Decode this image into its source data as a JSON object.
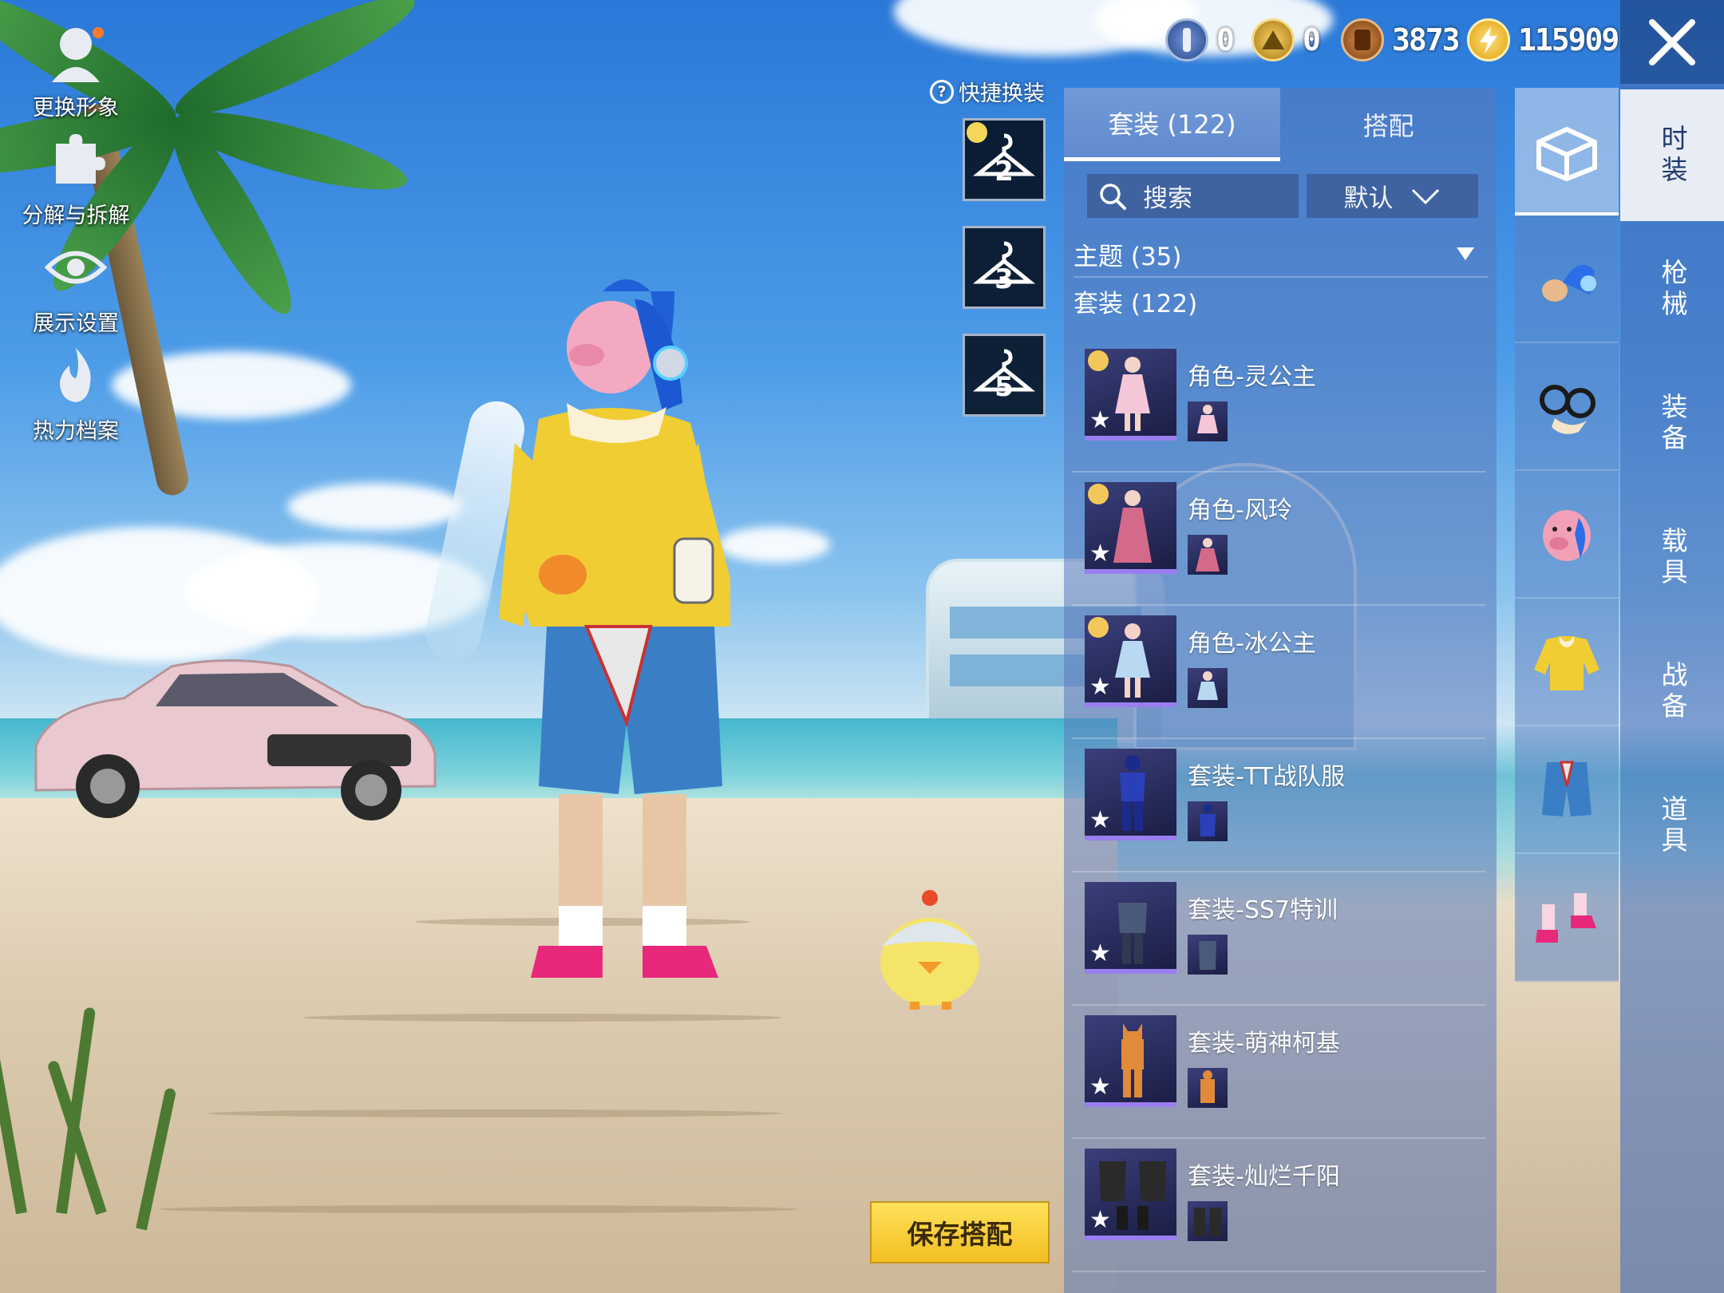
{
  "left_menu": [
    {
      "label": "更换形象",
      "icon": "avatar-icon"
    },
    {
      "label": "分解与拆解",
      "icon": "puzzle-icon"
    },
    {
      "label": "展示设置",
      "icon": "eye-icon"
    },
    {
      "label": "热力档案",
      "icon": "flame-icon"
    }
  ],
  "currencies": [
    {
      "icon": "blue-coin-icon",
      "value": "0",
      "color": "#3b5fa8"
    },
    {
      "icon": "gold-emblem-icon",
      "value": "0",
      "color": "#d8a21a"
    },
    {
      "icon": "bronze-coin-icon",
      "value": "3873",
      "color": "#a86a2a"
    },
    {
      "icon": "lightning-coin-icon",
      "value": "115909",
      "color": "#f2c230"
    }
  ],
  "quick_switch": {
    "label": "快捷换装",
    "slots": [
      "2",
      "3",
      "5"
    ]
  },
  "tabs": [
    {
      "label": "套装 (122)",
      "active": true
    },
    {
      "label": "搭配",
      "active": false
    }
  ],
  "search": {
    "label": "搜索"
  },
  "sort": {
    "label": "默认"
  },
  "theme": {
    "label": "主题 (35)"
  },
  "set_heading": "套装 (122)",
  "items": [
    {
      "name": "角色-灵公主",
      "color": "#f4c6d8"
    },
    {
      "name": "角色-风玲",
      "color": "#d46a8a"
    },
    {
      "name": "角色-冰公主",
      "color": "#b9d8f2"
    },
    {
      "name": "套装-TT战队服",
      "color": "#2a3fb8"
    },
    {
      "name": "套装-SS7特训",
      "color": "#4a5a7a"
    },
    {
      "name": "套装-萌神柯基",
      "color": "#e08a3a"
    },
    {
      "name": "套装-灿烂千阳",
      "color": "#2a2a2a"
    }
  ],
  "save_button": "保存搭配",
  "categories": [
    {
      "icon": "wardrobe-box-icon",
      "active": true
    },
    {
      "icon": "headphones-icon",
      "active": false
    },
    {
      "icon": "glasses-icon",
      "active": false
    },
    {
      "icon": "pig-mask-icon",
      "active": false
    },
    {
      "icon": "yellow-jacket-icon",
      "active": false
    },
    {
      "icon": "shorts-icon",
      "active": false
    },
    {
      "icon": "shoes-icon",
      "active": false
    }
  ],
  "vertical_tabs": [
    {
      "label": "时装",
      "active": true
    },
    {
      "label": "枪械",
      "active": false
    },
    {
      "label": "装备",
      "active": false
    },
    {
      "label": "载具",
      "active": false
    },
    {
      "label": "战备",
      "active": false
    },
    {
      "label": "道具",
      "active": false
    }
  ]
}
